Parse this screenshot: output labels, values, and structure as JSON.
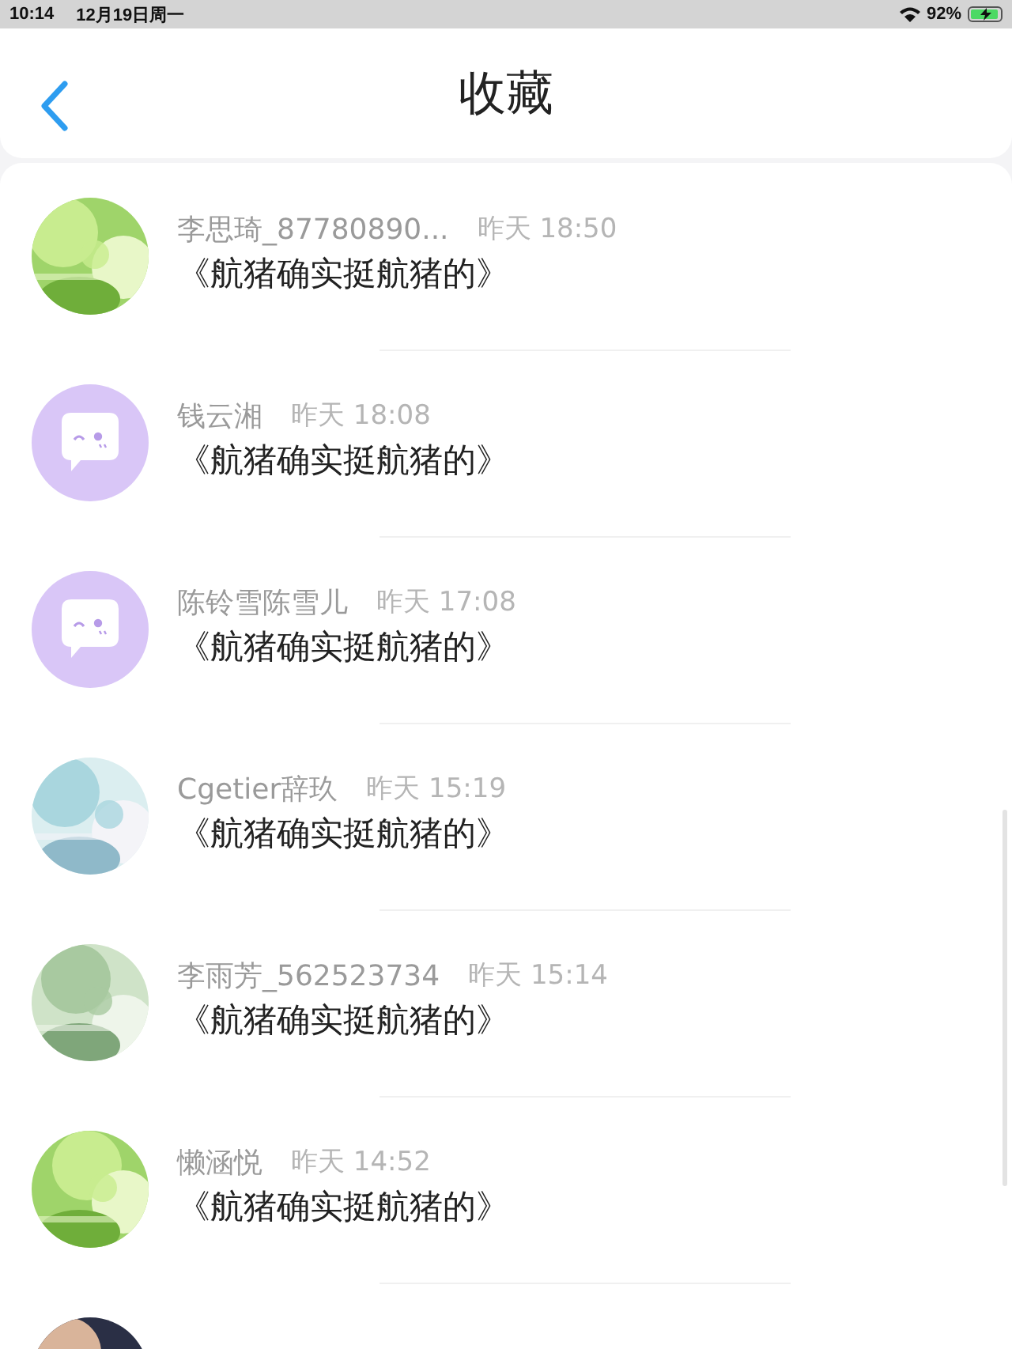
{
  "status_bar": {
    "time": "10:14",
    "date": "12月19日周一",
    "battery": "92%",
    "charging": true
  },
  "header": {
    "title": "收藏"
  },
  "items": [
    {
      "name": "李思琦_87780890...",
      "time": "昨天 18:50",
      "title": "《航猪确实挺航猪的》",
      "avatar": {
        "kind": "picture"
      }
    },
    {
      "name": "钱云湘",
      "time": "昨天 18:08",
      "title": "《航猪确实挺航猪的》",
      "avatar": {
        "kind": "bubble"
      }
    },
    {
      "name": "陈铃雪陈雪儿",
      "time": "昨天 17:08",
      "title": "《航猪确实挺航猪的》",
      "avatar": {
        "kind": "bubble"
      }
    },
    {
      "name": "Cgetier辞玖",
      "time": "昨天 15:19",
      "title": "《航猪确实挺航猪的》",
      "avatar": {
        "kind": "picture"
      }
    },
    {
      "name": "李雨芳_562523734",
      "time": "昨天 15:14",
      "title": "《航猪确实挺航猪的》",
      "avatar": {
        "kind": "picture"
      }
    },
    {
      "name": "懒涵悦",
      "time": "昨天 14:52",
      "title": "《航猪确实挺航猪的》",
      "avatar": {
        "kind": "picture"
      }
    },
    {
      "avatar": {
        "kind": "picture"
      }
    }
  ]
}
